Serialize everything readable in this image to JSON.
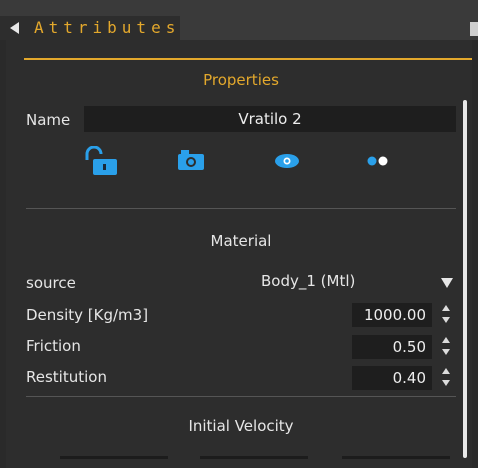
{
  "header": {
    "title": "Attributes"
  },
  "properties": {
    "title": "Properties",
    "name_label": "Name",
    "name_value": "Vratilo 2",
    "icons": [
      "unlock-icon",
      "camera-icon",
      "eye-icon",
      "two-dots-icon"
    ]
  },
  "material": {
    "title": "Material",
    "source_label": "source",
    "source_value": "Body_1 (Mtl)",
    "density_label": "Density [Kg/m3]",
    "density_value": "1000.00",
    "friction_label": "Friction",
    "friction_value": "0.50",
    "restitution_label": "Restitution",
    "restitution_value": "0.40"
  },
  "initial_velocity": {
    "title": "Initial Velocity"
  },
  "colors": {
    "accent": "#e3a82c",
    "icon_blue": "#2aa0ea",
    "panel": "#2d2d2d",
    "field": "#1e1e1e"
  }
}
